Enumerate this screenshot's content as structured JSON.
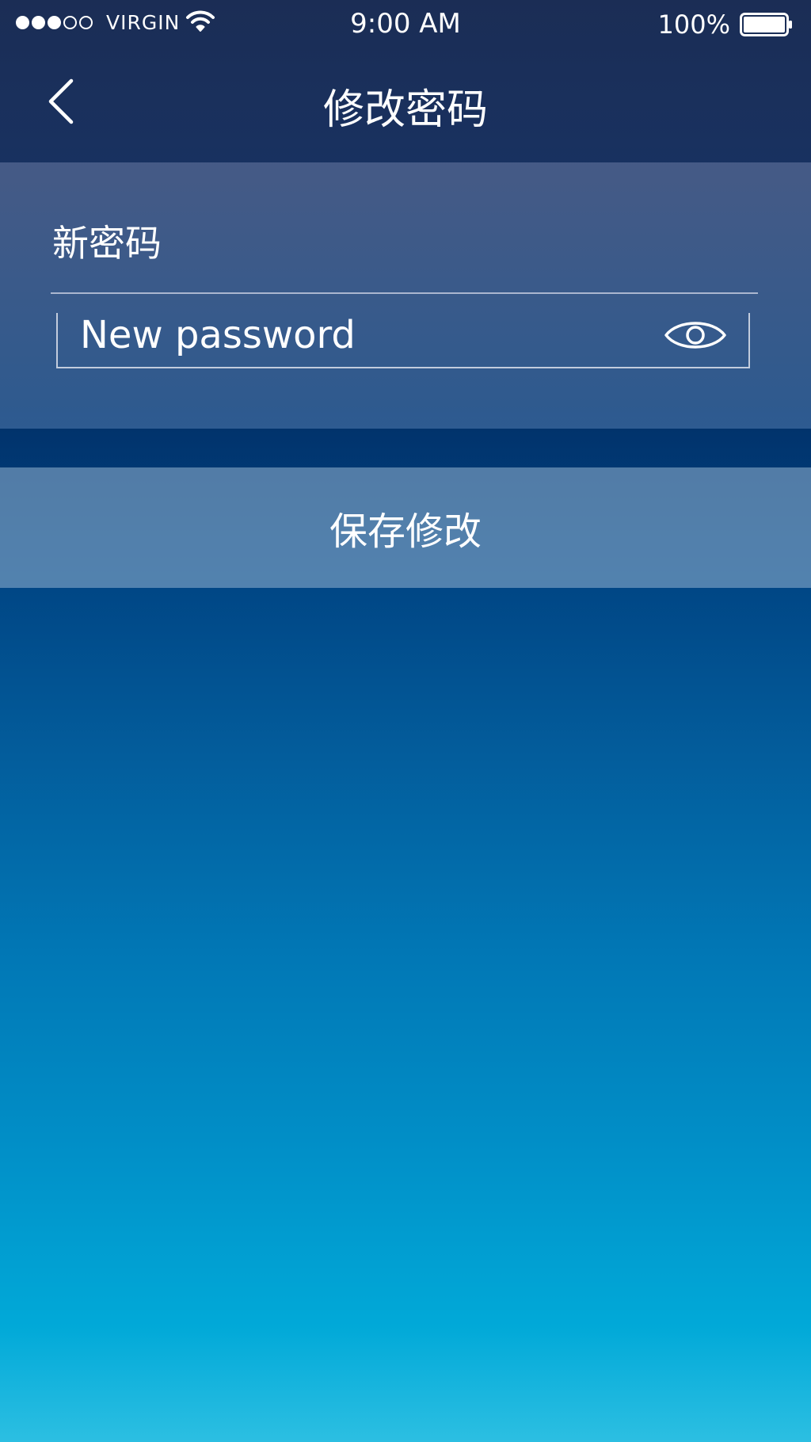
{
  "status_bar": {
    "signal_bars_filled": 3,
    "signal_bars_total": 5,
    "carrier": "VIRGIN",
    "time": "9:00 AM",
    "battery_percent": "100%",
    "icons": [
      "signal-dots-icon",
      "wifi-icon",
      "battery-icon"
    ]
  },
  "nav": {
    "back_icon": "chevron-left-icon",
    "title": "修改密码"
  },
  "form": {
    "field_label": "新密码",
    "password_placeholder": "New password",
    "password_value": "",
    "visibility_icon": "eye-icon"
  },
  "actions": {
    "save_label": "保存修改"
  },
  "colors": {
    "background_top": "#1b2d55",
    "background_bottom": "#2cbfe2",
    "text": "#ffffff"
  }
}
